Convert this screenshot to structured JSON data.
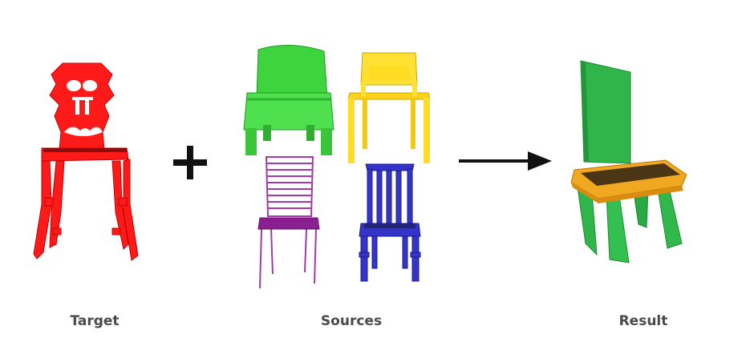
{
  "labels": {
    "target": "Target",
    "sources": "Sources",
    "result": "Result"
  },
  "icons": {
    "combine": "plus-icon",
    "transform": "right-arrow-icon"
  },
  "colors": {
    "target_chair": "#ff1a1a",
    "source_green": "#3ed43e",
    "source_yellow": "#ffe033",
    "source_purple": "#a23aa8",
    "source_blue": "#3434c8",
    "result_back": "#2fb54a",
    "result_seat": "#f0a821",
    "label_text": "#4a4a4a"
  }
}
